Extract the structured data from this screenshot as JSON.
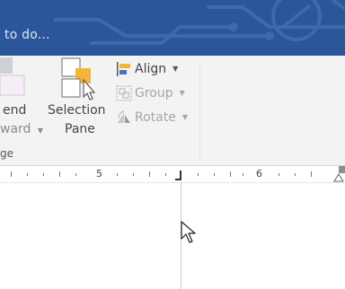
{
  "titlebar": {
    "tell_me_text": "to do..."
  },
  "ribbon": {
    "send_backward": {
      "line1": "end",
      "line2": "ward"
    },
    "selection_pane": {
      "line1": "Selection",
      "line2": "Pane"
    },
    "align": {
      "label": "Align"
    },
    "group": {
      "label": "Group"
    },
    "rotate": {
      "label": "Rotate"
    },
    "group_label": "ge"
  },
  "ruler": {
    "labels": [
      "5",
      "6"
    ]
  },
  "colors": {
    "titlebar": "#2b579a",
    "ribbon": "#f3f3f3",
    "selection_icon_accent": "#f2b53a",
    "align_icon_accent": "#4472c4"
  }
}
